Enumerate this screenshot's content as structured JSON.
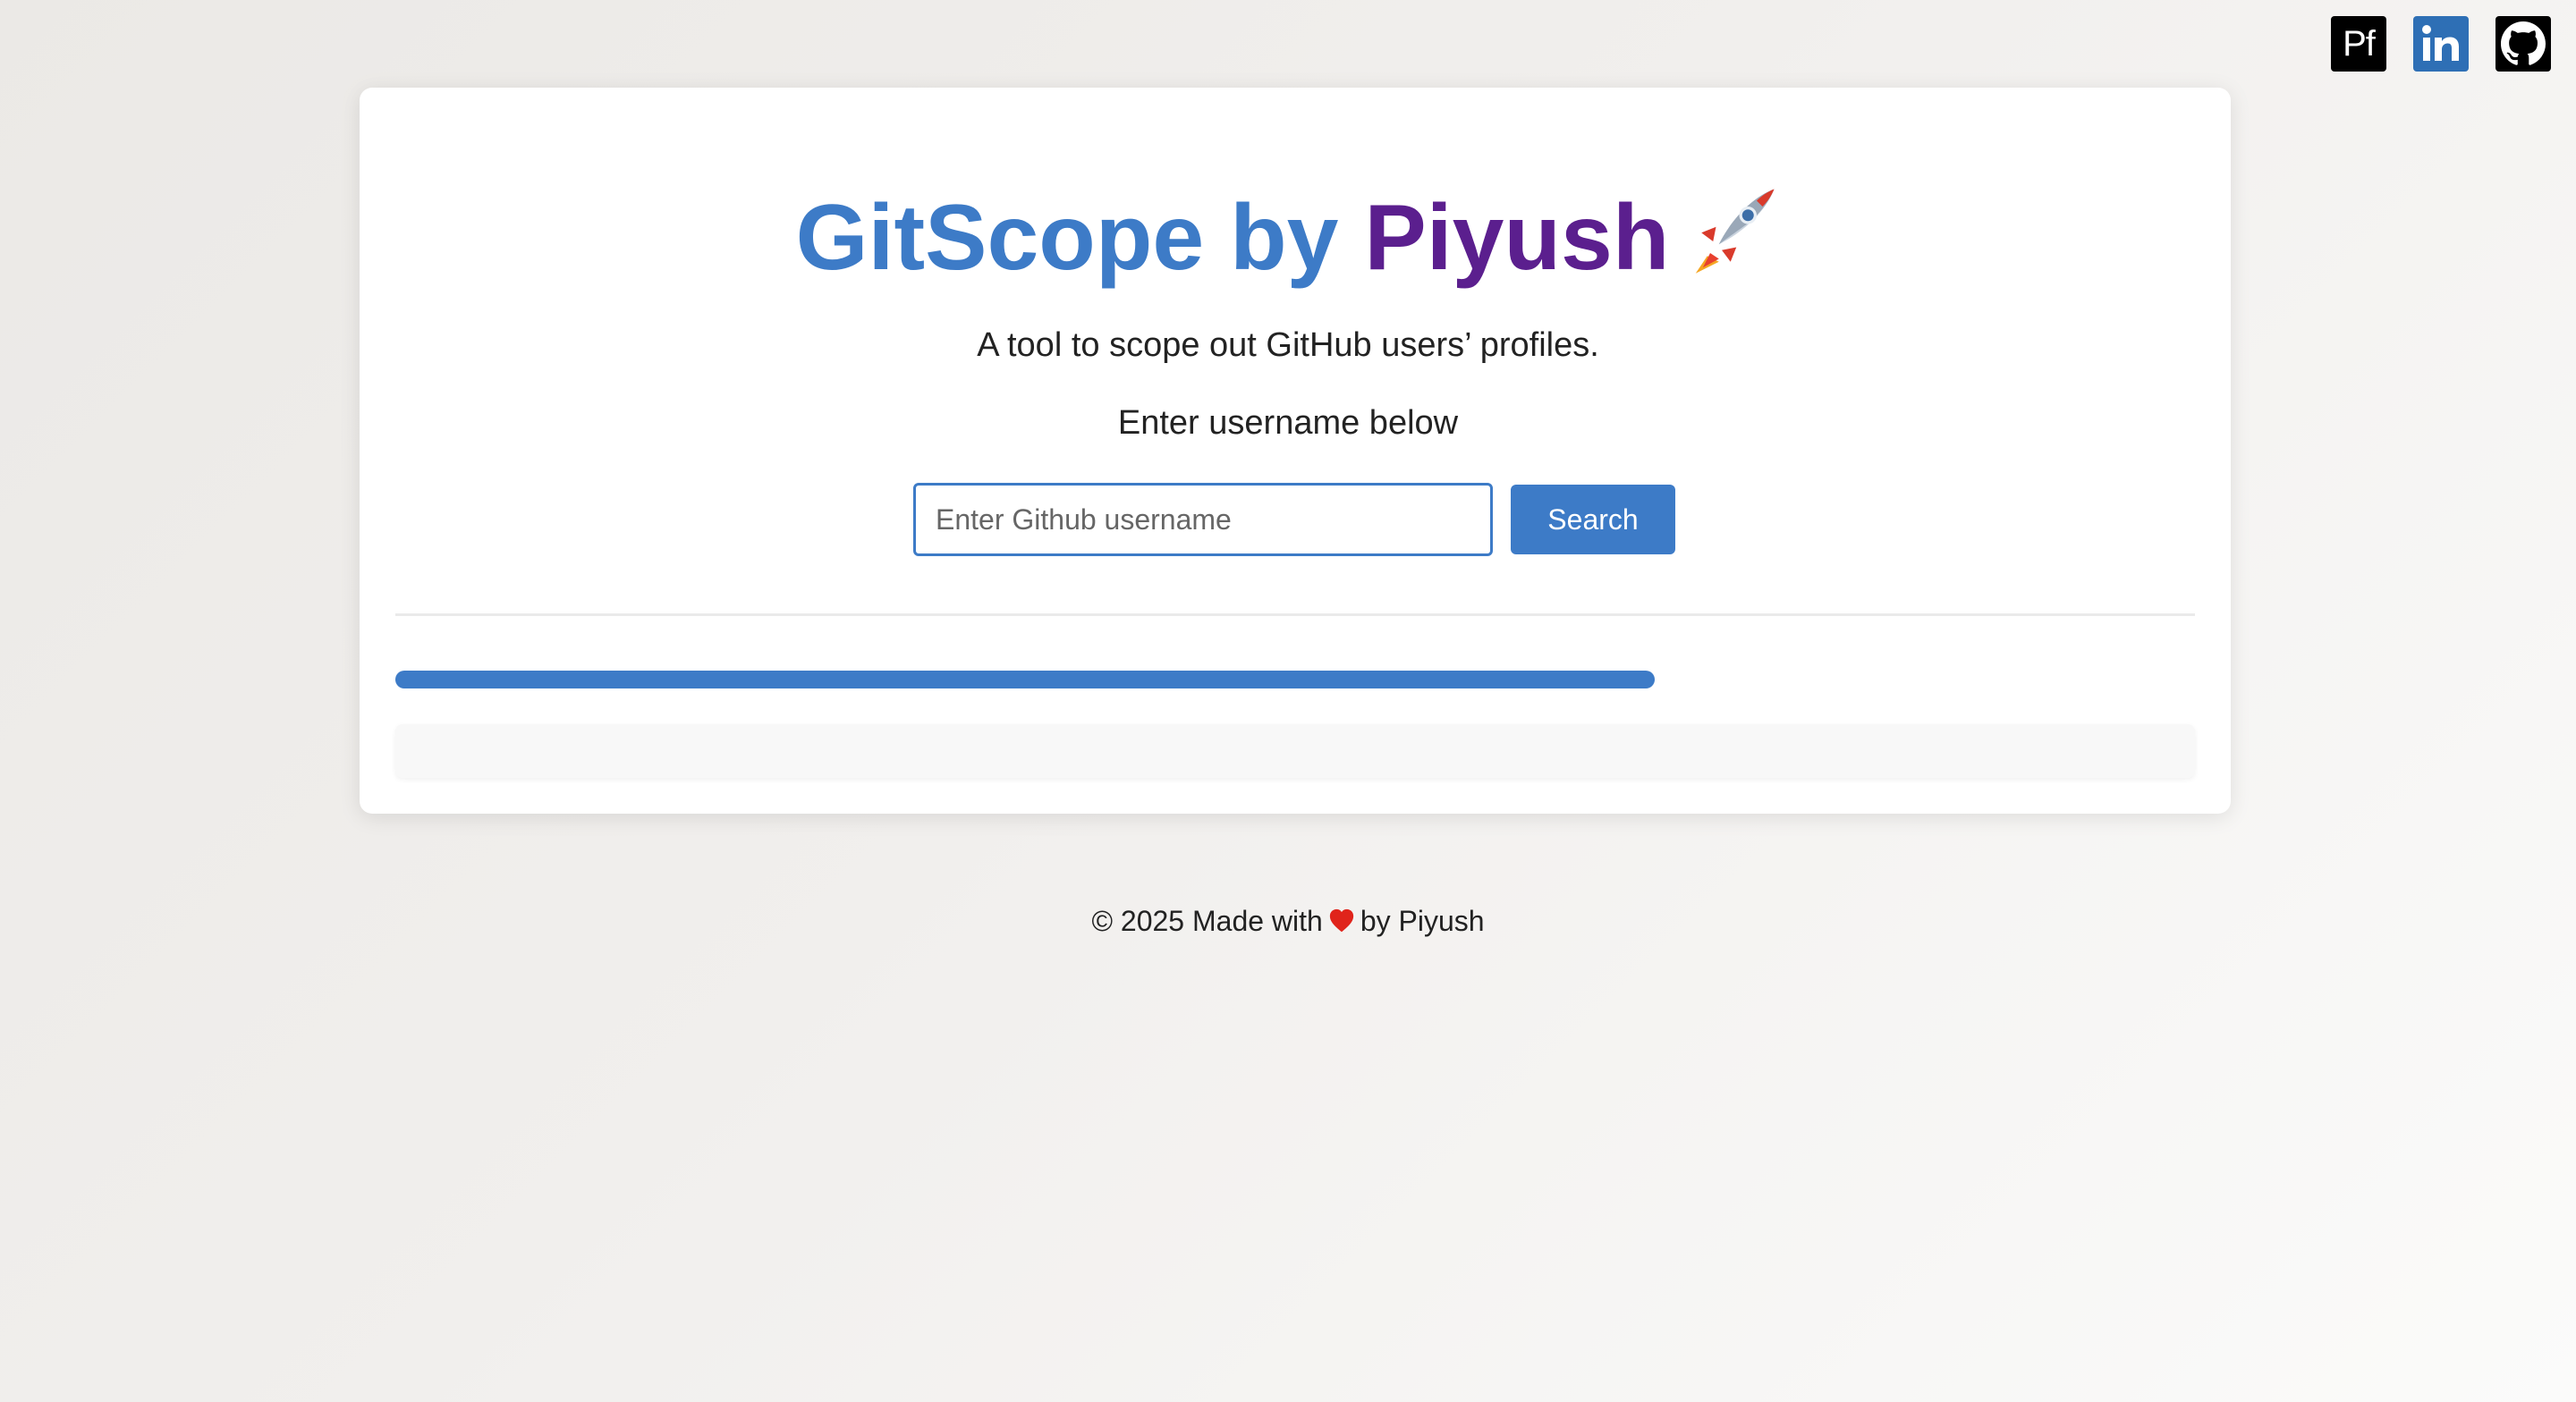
{
  "social": {
    "portfolio_label": "Pf",
    "items": [
      "portfolio",
      "linkedin",
      "github"
    ]
  },
  "header": {
    "title_part1": "GitScope by ",
    "title_part2": "Piyush",
    "title_icon": "rocket-icon",
    "subtitle": "A tool to scope out GitHub users’ profiles.",
    "prompt": "Enter username below"
  },
  "search": {
    "placeholder": "Enter Github username",
    "value": "",
    "button_label": "Search"
  },
  "progress": {
    "fraction": 0.7
  },
  "footer": {
    "prefix": "© 2025 Made with",
    "icon": "heart-icon",
    "suffix": "by Piyush"
  },
  "colors": {
    "accent": "#3d7bc7",
    "purple": "#5b1f8e",
    "linkedin": "#2e6fb5",
    "heart": "#e0241b"
  }
}
